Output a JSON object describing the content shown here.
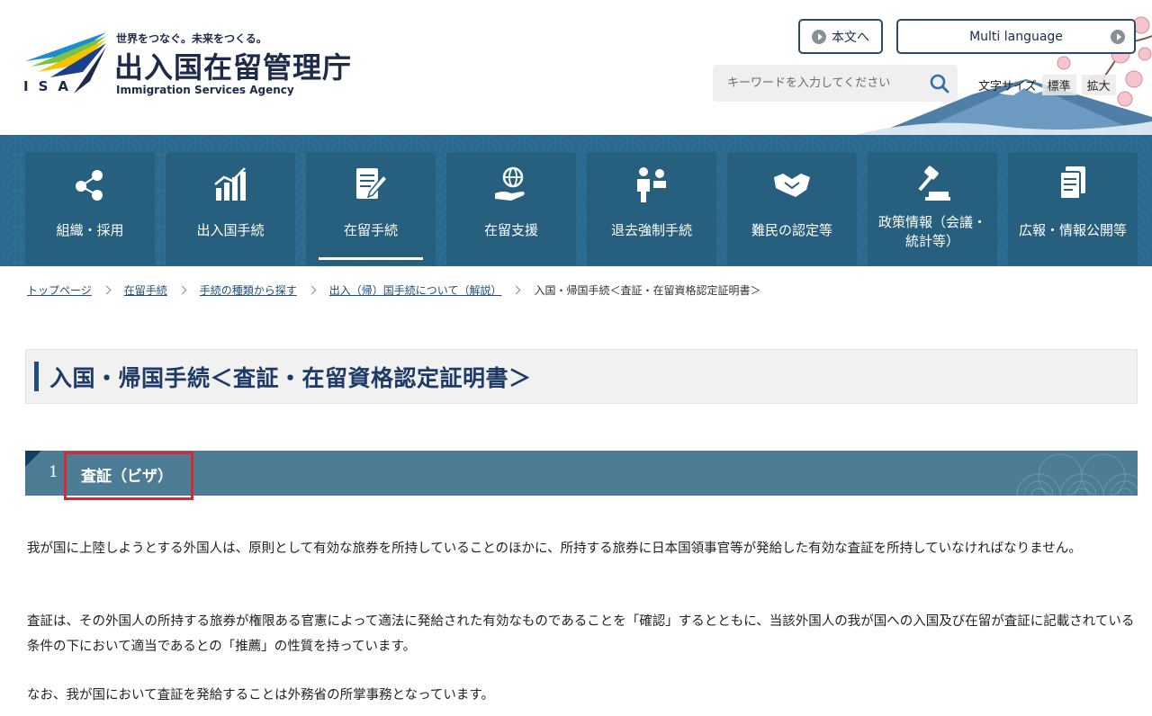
{
  "header": {
    "logo_isa": "ISA",
    "logo_tagline": "世界をつなぐ。未来をつくる。",
    "logo_title": "出入国在留管理庁",
    "logo_subtitle": "Immigration Services Agency",
    "skip_label": "本文へ",
    "lang_label": "Multi language",
    "search_placeholder": "キーワードを入力してください",
    "fontsize_label": "文字サイズ",
    "fontsize_standard": "標準",
    "fontsize_large": "拡大"
  },
  "nav": {
    "items": [
      {
        "label": "組織・採用",
        "icon": "organization-icon"
      },
      {
        "label": "出入国手続",
        "icon": "chart-icon"
      },
      {
        "label": "在留手続",
        "icon": "document-pen-icon",
        "active": true
      },
      {
        "label": "在留支援",
        "icon": "globe-hand-icon"
      },
      {
        "label": "退去強制手続",
        "icon": "people-icon"
      },
      {
        "label": "難民の認定等",
        "icon": "handshake-icon"
      },
      {
        "label": "政策情報（会議・",
        "label2": "統計等）",
        "icon": "gavel-icon"
      },
      {
        "label": "広報・情報公開等",
        "icon": "documents-icon"
      }
    ]
  },
  "breadcrumb": {
    "items": [
      "トップページ",
      "在留手続",
      "手続の種類から探す",
      "出入（帰）国手続について（解説）"
    ],
    "current": "入国・帰国手続＜査証・在留資格認定証明書＞"
  },
  "page": {
    "title": "入国・帰国手続＜査証・在留資格認定証明書＞",
    "section_number": "1",
    "section_title": "査証（ビザ）",
    "paragraphs": [
      "我が国に上陸しようとする外国人は、原則として有効な旅券を所持していることのほかに、所持する旅券に日本国領事官等が発給した有効な査証を所持していなければなりません。",
      "査証は、その外国人の所持する旅券が権限ある官憲によって適法に発給された有効なものであることを「確認」するとともに、当該外国人の我が国への入国及び在留が査証に記載されている条件の下において適当であるとの「推薦」の性質を持っています。",
      "なお、我が国において査証を発給することは外務省の所掌事務となっています。"
    ]
  },
  "colors": {
    "nav_bg": "#2b6a8e",
    "nav_tile": "#27607f",
    "section_bar": "#4d7d95",
    "title_accent": "#1f4e79",
    "highlight": "#d62a33"
  }
}
